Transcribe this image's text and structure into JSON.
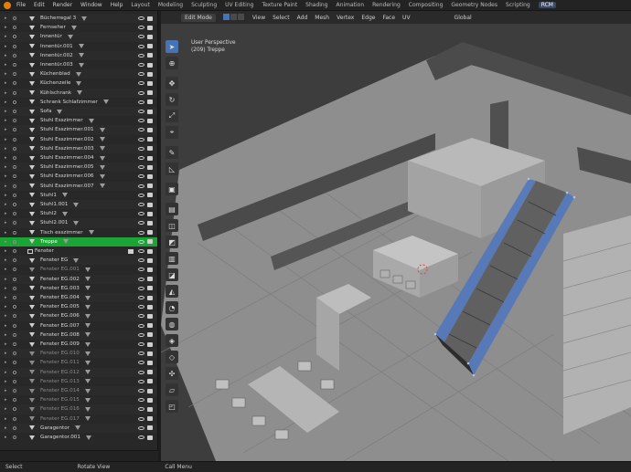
{
  "topbar": {
    "menus": [
      "File",
      "Edit",
      "Render",
      "Window",
      "Help"
    ],
    "workspaces": [
      "Layout",
      "Modeling",
      "Sculpting",
      "UV Editing",
      "Texture Paint",
      "Shading",
      "Animation",
      "Rendering",
      "Compositing",
      "Geometry Nodes",
      "Scripting",
      "RCM"
    ],
    "active_workspace": "RCM"
  },
  "outliner": {
    "rows": [
      {
        "label": "Bücherregal 3"
      },
      {
        "label": "Fernseher"
      },
      {
        "label": "Innentür"
      },
      {
        "label": "Innentür.001"
      },
      {
        "label": "Innentür.002"
      },
      {
        "label": "Innentür.003"
      },
      {
        "label": "Küchenblad"
      },
      {
        "label": "Küchenzeile"
      },
      {
        "label": "Kühlschrank"
      },
      {
        "label": "Schrank Schlafzimmer"
      },
      {
        "label": "Sofa"
      },
      {
        "label": "Stuhl Esszimmer"
      },
      {
        "label": "Stuhl Esszimmer.001"
      },
      {
        "label": "Stuhl Esszimmer.002"
      },
      {
        "label": "Stuhl Esszimmer.003"
      },
      {
        "label": "Stuhl Esszimmer.004"
      },
      {
        "label": "Stuhl Esszimmer.005"
      },
      {
        "label": "Stuhl Esszimmer.006"
      },
      {
        "label": "Stuhl Esszimmer.007"
      },
      {
        "label": "Stuhl1"
      },
      {
        "label": "Stuhl1.001"
      },
      {
        "label": "Stuhl2"
      },
      {
        "label": "Stuhl2.001"
      },
      {
        "label": "Tisch esszimmer"
      },
      {
        "label": "Treppe"
      },
      {
        "label": "Fenster"
      },
      {
        "label": "Fenster EG"
      },
      {
        "label": "Fenster EG.001"
      },
      {
        "label": "Fenster EG.002"
      },
      {
        "label": "Fenster EG.003"
      },
      {
        "label": "Fenster EG.004"
      },
      {
        "label": "Fenster EG.005"
      },
      {
        "label": "Fenster EG.006"
      },
      {
        "label": "Fenster EG.007"
      },
      {
        "label": "Fenster EG.008"
      },
      {
        "label": "Fenster EG.009"
      },
      {
        "label": "Fenster EG.010"
      },
      {
        "label": "Fenster EG.011"
      },
      {
        "label": "Fenster EG.012"
      },
      {
        "label": "Fenster EG.013"
      },
      {
        "label": "Fenster EG.014"
      },
      {
        "label": "Fenster EG.015"
      },
      {
        "label": "Fenster EG.016"
      },
      {
        "label": "Fenster EG.017"
      },
      {
        "label": "Garagentor"
      },
      {
        "label": "Garagentor.001"
      }
    ]
  },
  "viewport": {
    "mode": "Edit Mode",
    "menus": [
      "View",
      "Select",
      "Add",
      "Mesh",
      "Vertex",
      "Edge",
      "Face",
      "UV"
    ],
    "orientation": "Global",
    "view_name": "User Perspective",
    "object_info": "(209) Treppe"
  },
  "statusbar": {
    "items": [
      "Select",
      "Rotate View",
      "Call Menu"
    ]
  }
}
